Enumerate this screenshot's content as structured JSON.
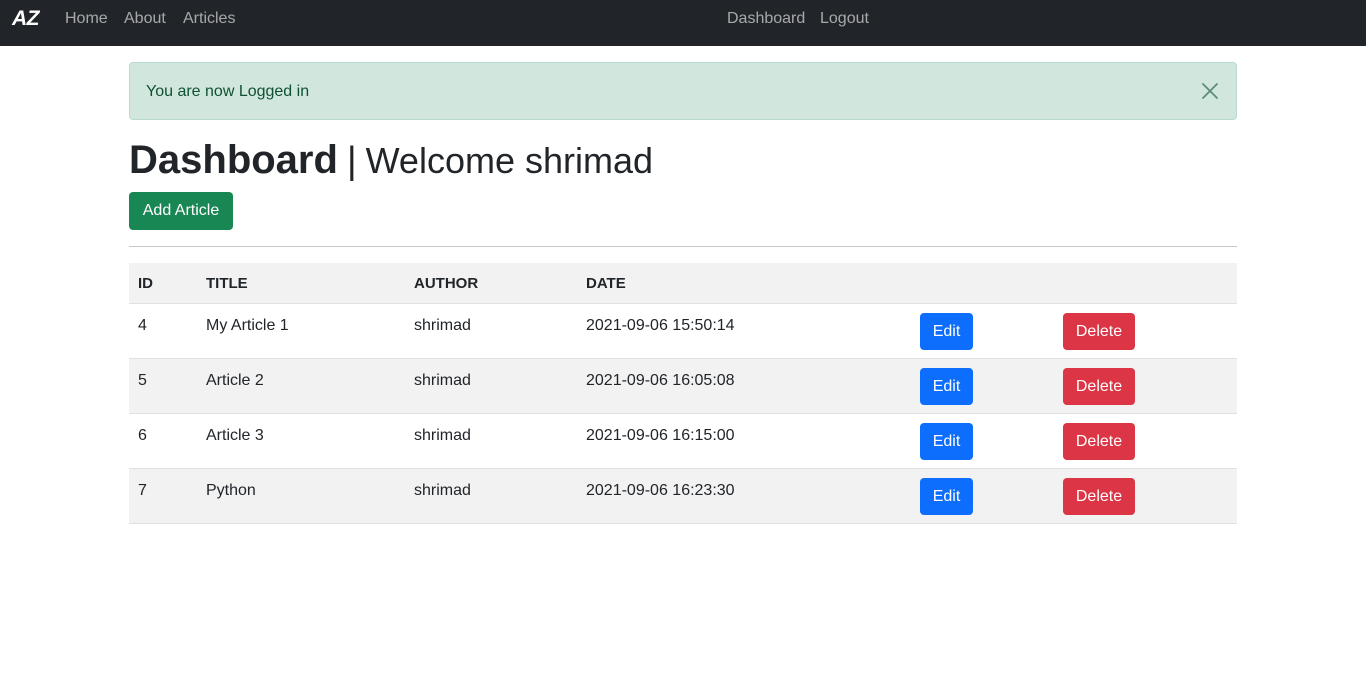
{
  "nav": {
    "brand": "AZ",
    "links": [
      "Home",
      "About",
      "Articles"
    ],
    "right_links": [
      "Dashboard",
      "Logout"
    ]
  },
  "alert": {
    "message": "You are now Logged in",
    "close_icon": "close-icon"
  },
  "page": {
    "title": "Dashboard",
    "separator": "|",
    "welcome": "Welcome shrimad",
    "add_button": "Add Article"
  },
  "table": {
    "headers": [
      "ID",
      "TITLE",
      "AUTHOR",
      "DATE"
    ],
    "rows": [
      {
        "id": "4",
        "title": "My Article 1",
        "author": "shrimad",
        "date": "2021-09-06 15:50:14",
        "edit": "Edit",
        "delete": "Delete"
      },
      {
        "id": "5",
        "title": "Article 2",
        "author": "shrimad",
        "date": "2021-09-06 16:05:08",
        "edit": "Edit",
        "delete": "Delete"
      },
      {
        "id": "6",
        "title": "Article 3",
        "author": "shrimad",
        "date": "2021-09-06 16:15:00",
        "edit": "Edit",
        "delete": "Delete"
      },
      {
        "id": "7",
        "title": "Python",
        "author": "shrimad",
        "date": "2021-09-06 16:23:30",
        "edit": "Edit",
        "delete": "Delete"
      }
    ]
  },
  "colors": {
    "navbar": "#212529",
    "alert_bg": "#d1e7dd",
    "success": "#198754",
    "primary": "#0d6efd",
    "danger": "#dc3545"
  }
}
